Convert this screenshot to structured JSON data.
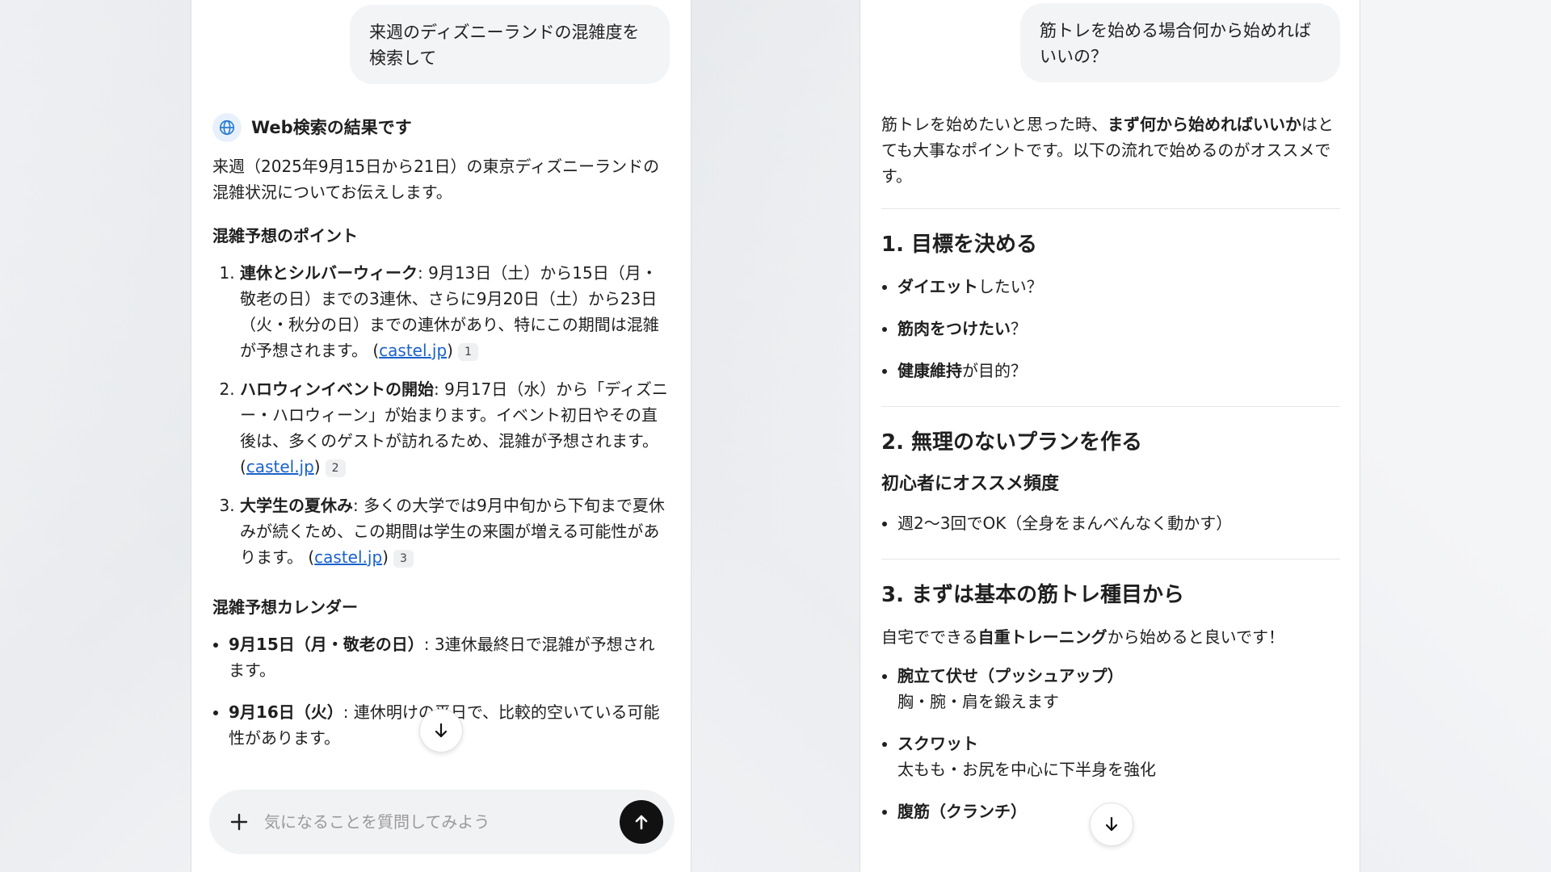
{
  "left": {
    "user_message": "来週のディズニーランドの混雑度を検索して",
    "web_result_title": "Web検索の結果です",
    "intro": "来週（2025年9月15日から21日）の東京ディズニーランドの混雑状況についてお伝えします。",
    "points_heading": "混雑予想のポイント",
    "points": [
      {
        "title": "連休とシルバーウィーク",
        "text": ": 9月13日（土）から15日（月・敬老の日）までの3連休、さらに9月20日（土）から23日（火・秋分の日）までの連休があり、特にこの期間は混雑が予想されます。",
        "link": "castel.jp",
        "cite": "1"
      },
      {
        "title": "ハロウィンイベントの開始",
        "text": ": 9月17日（水）から「ディズニー・ハロウィーン」が始まります。イベント初日やその直後は、多くのゲストが訪れるため、混雑が予想されます。",
        "link": "castel.jp",
        "cite": "2"
      },
      {
        "title": "大学生の夏休み",
        "text": ": 多くの大学では9月中旬から下旬まで夏休みが続くため、この期間は学生の来園が増える可能性があります。",
        "link": "castel.jp",
        "cite": "3"
      }
    ],
    "calendar_heading": "混雑予想カレンダー",
    "calendar": [
      {
        "title": "9月15日（月・敬老の日）",
        "text": ": 3連休最終日で混雑が予想されます。"
      },
      {
        "title": "9月16日（火）",
        "text": ": 連休明けの平日で、比較的空いている可能性があります。"
      }
    ],
    "composer_placeholder": "気になることを質問してみよう"
  },
  "right": {
    "user_message": "筋トレを始める場合何から始めればいいの？",
    "intro_before": "筋トレを始めたいと思った時、",
    "intro_bold": "まず何から始めればいいか",
    "intro_after": "はとても大事なポイントです。以下の流れで始めるのがオススメです。",
    "section1_title": "1. 目標を決める",
    "goals": [
      {
        "bold": "ダイエット",
        "rest": "したい？"
      },
      {
        "bold": "筋肉をつけたい",
        "rest": "？"
      },
      {
        "bold": "健康維持",
        "rest": "が目的？"
      }
    ],
    "section2_title": "2. 無理のないプランを作る",
    "section2_sub": "初心者にオススメ頻度",
    "frequency": "週2〜3回でOK（全身をまんべんなく動かす）",
    "section3_title": "3. まずは基本の筋トレ種目から",
    "section3_intro_before": "自宅でできる",
    "section3_intro_bold": "自重トレーニング",
    "section3_intro_after": "から始めると良いです！",
    "exercises": [
      {
        "name": "腕立て伏せ（プッシュアップ）",
        "desc": "胸・腕・肩を鍛えます"
      },
      {
        "name": "スクワット",
        "desc": "太もも・お尻を中心に下半身を強化"
      },
      {
        "name": "腹筋（クランチ）",
        "desc": ""
      }
    ]
  }
}
